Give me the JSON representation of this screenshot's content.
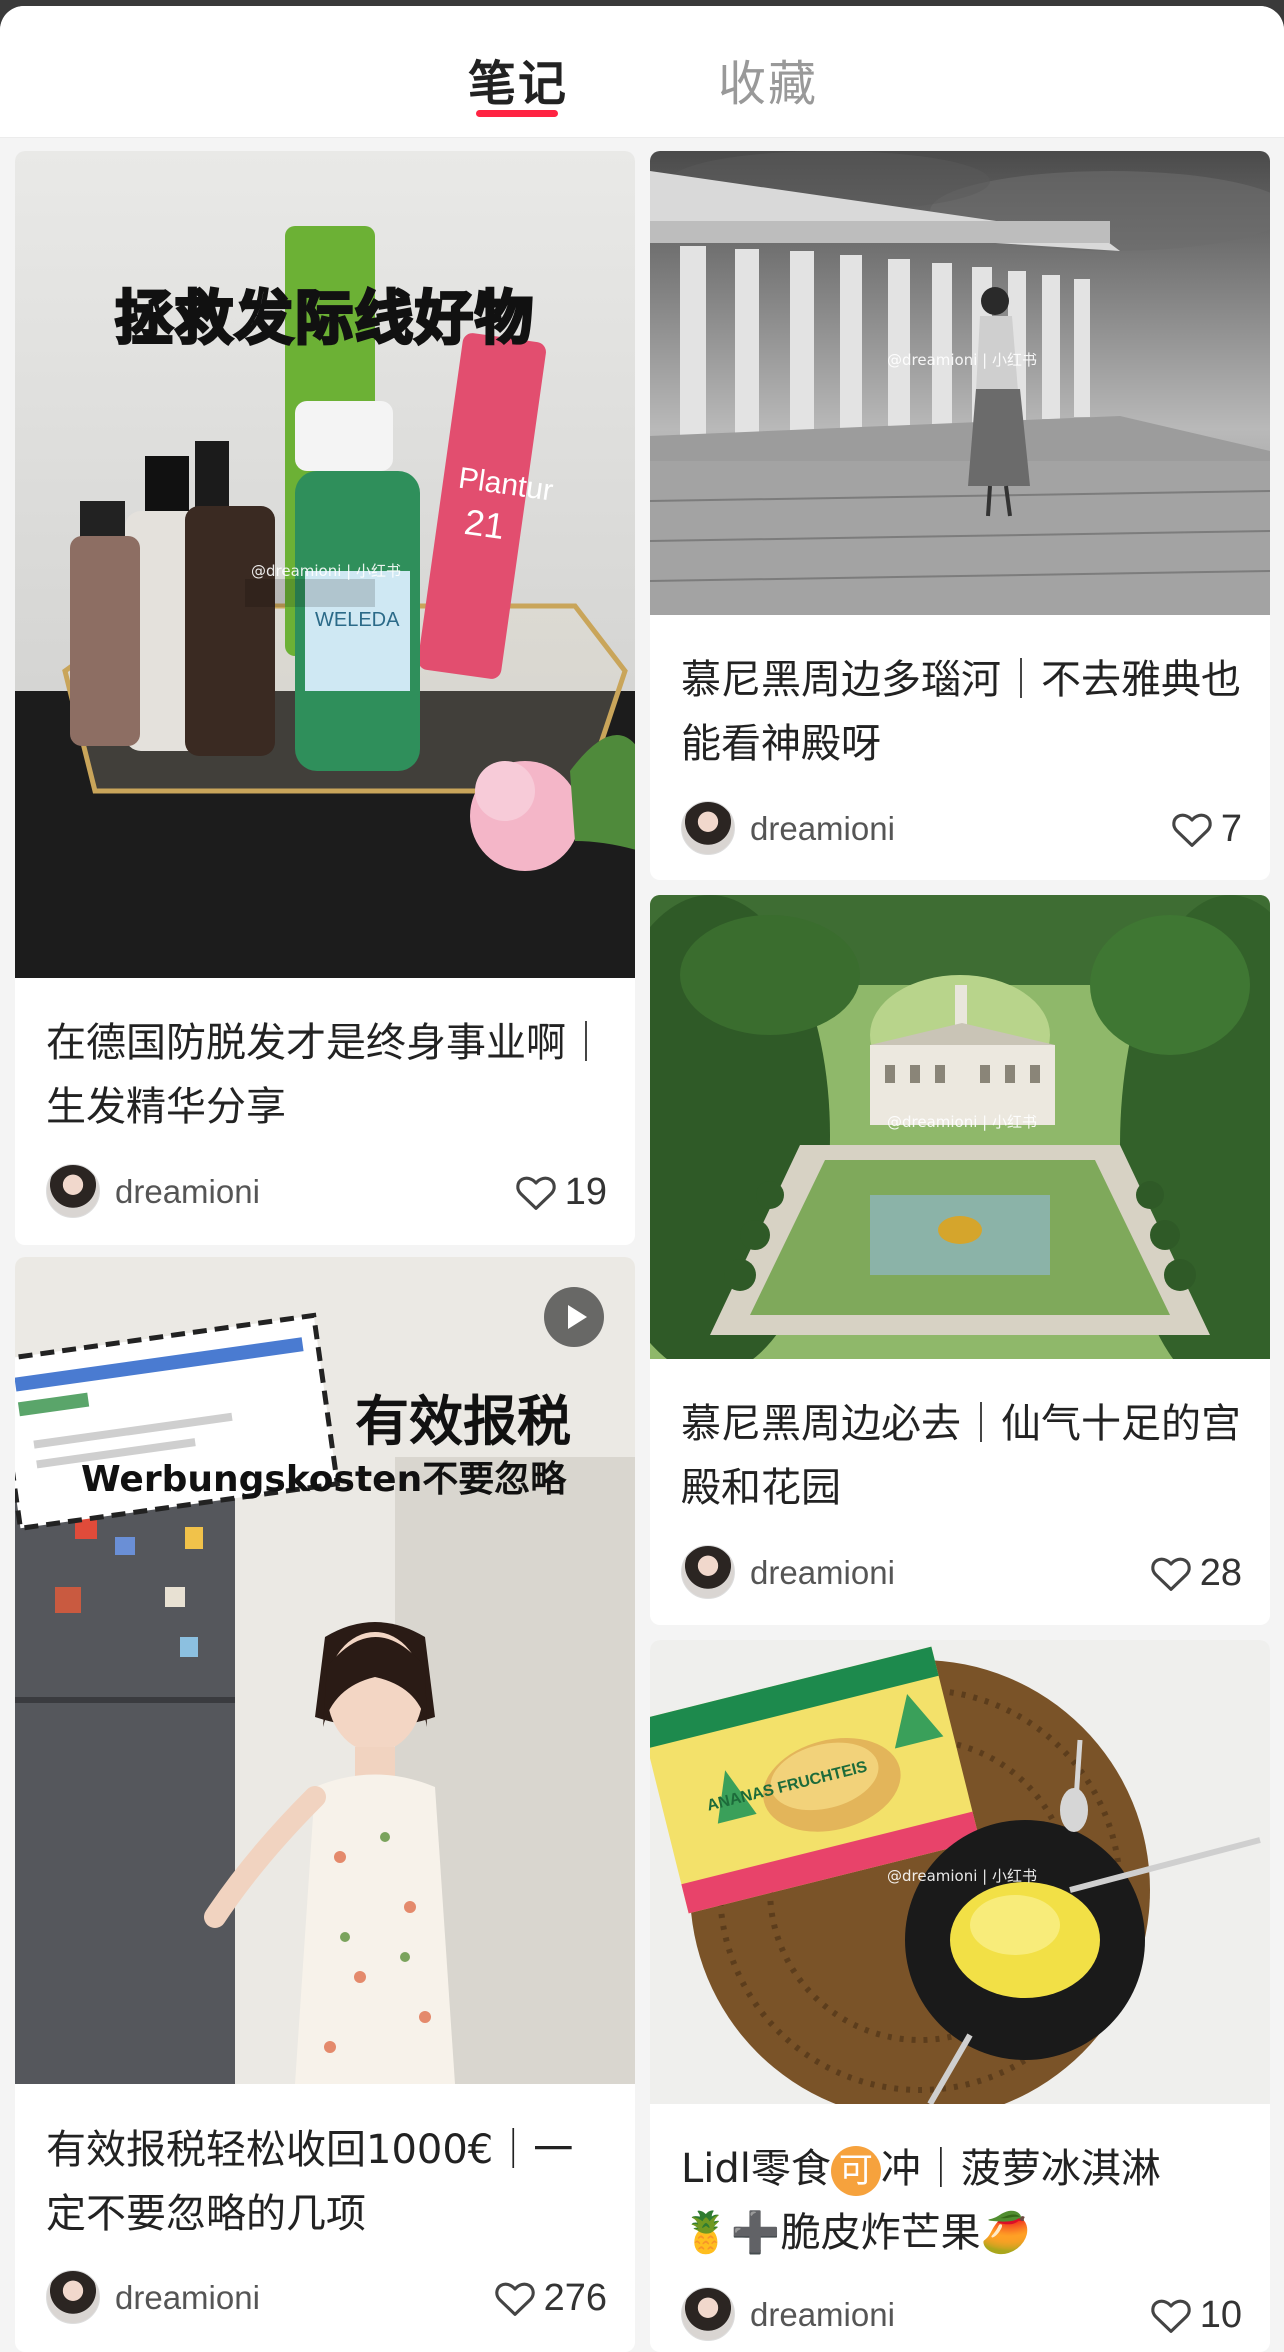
{
  "tabs": [
    {
      "label": "笔记",
      "active": true
    },
    {
      "label": "收藏",
      "active": false
    }
  ],
  "accent_color": "#ff2442",
  "watermark": "@dreamioni | 小红书",
  "notes": [
    {
      "title": "在德国防脱发才是终身事业啊｜生发精华分享",
      "cover_text": "拯救发际线好物",
      "author": "dreamioni",
      "likes": "19"
    },
    {
      "title": "慕尼黑周边多瑙河｜不去雅典也能看神殿呀",
      "author": "dreamioni",
      "likes": "7"
    },
    {
      "title": "慕尼黑周边必去｜仙气十足的宫殿和花园",
      "author": "dreamioni",
      "likes": "28"
    },
    {
      "title": "有效报税轻松收回1000€｜一定不要忽略的几项",
      "cover_text": "有效报税",
      "cover_subtext": "Werbungskosten不要忽略",
      "author": "dreamioni",
      "likes": "276",
      "is_video": true
    },
    {
      "title_parts": [
        "Lidl零食",
        "可",
        "冲｜菠萝冰淇淋",
        "🍍",
        "➕脆皮炸芒果",
        "🥭"
      ],
      "cover_text": "ANANAS FRUCHTEIS",
      "author": "dreamioni",
      "likes": "10"
    }
  ]
}
